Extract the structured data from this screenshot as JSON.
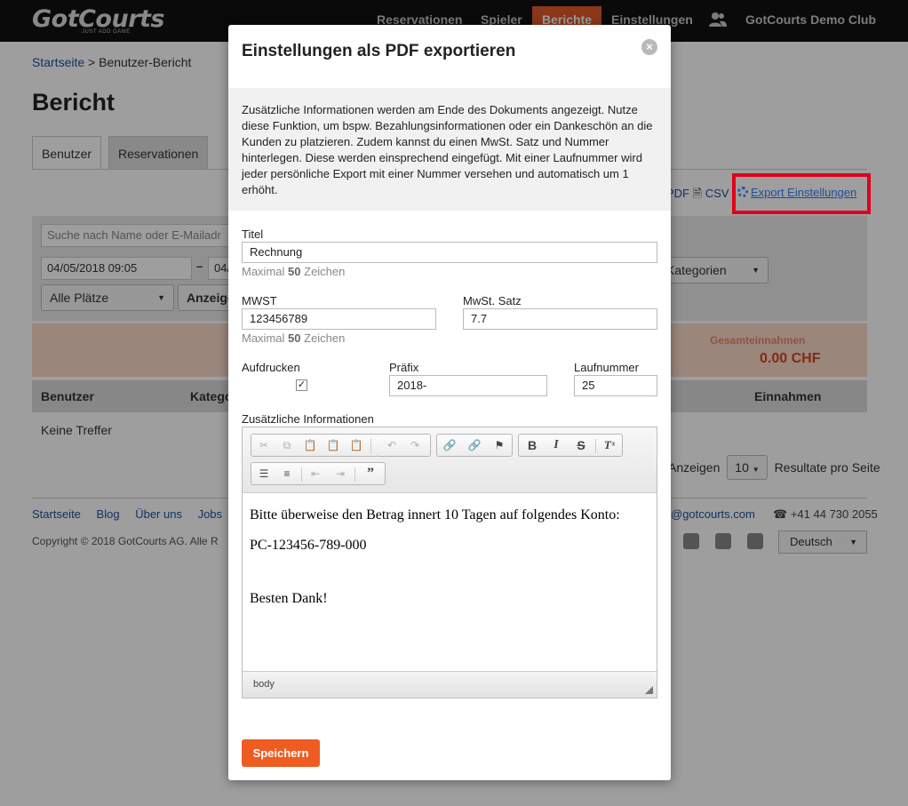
{
  "nav": {
    "logo": "GotCourts",
    "logo_tagline": "JUST ADD GAME",
    "items": [
      "Reservationen",
      "Spieler",
      "Berichte",
      "Einstellungen"
    ],
    "club": "GotCourts Demo Club"
  },
  "page": {
    "breadcrumb_home": "Startseite",
    "breadcrumb_sep": ">",
    "breadcrumb_current": "Benutzer-Bericht",
    "title": "Bericht",
    "tabs": [
      "Benutzer",
      "Reservationen"
    ],
    "export_pdf": "PDF",
    "export_csv": "CSV",
    "export_settings": "Export Einstellungen",
    "search_placeholder": "Suche nach Name oder E-Mailadr",
    "date_from": "04/05/2018 09:05",
    "date_dash": "–",
    "date_to": "04/",
    "courts_select": "Alle Plätze",
    "show_button": "Anzeige",
    "categories_select": "Kategorien",
    "summary_label": "Gesamteinnahmen",
    "summary_value": "0.00 CHF",
    "columns": [
      "Benutzer",
      "Katego",
      "Einnahmen"
    ],
    "no_results": "Keine Treffer",
    "pager_show": "Anzeigen",
    "pager_count": "10",
    "pager_suffix": "Resultate pro Seite"
  },
  "footer": {
    "links": [
      "Startseite",
      "Blog",
      "Über uns",
      "Jobs"
    ],
    "copyright": "Copyright © 2018 GotCourts AG. Alle R",
    "email": "@gotcourts.com",
    "phone": "+41 44 730 2055",
    "language": "Deutsch"
  },
  "modal": {
    "title": "Einstellungen als PDF exportieren",
    "close_symbol": "×",
    "info": "Zusätzliche Informationen werden am Ende des Dokuments angezeigt. Nutze diese Funktion, um bspw. Bezahlungsinformationen oder ein Dankeschön an die Kunden zu platzieren. Zudem kannst du einen MwSt. Satz und Nummer hinterlegen. Diese werden einsprechend eingefügt. Mit einer Laufnummer wird jeder persönliche Export mit einer Nummer versehen und automatisch um 1 erhöht.",
    "title_label": "Titel",
    "title_value": "Rechnung",
    "max_prefix": "Maximal",
    "max_count": "50",
    "max_suffix": "Zeichen",
    "vat_label": "MWST",
    "vat_value": "123456789",
    "vat_rate_label": "MwSt. Satz",
    "vat_rate_value": "7.7",
    "print_label": "Aufdrucken",
    "print_checked": true,
    "prefix_label": "Präfix",
    "prefix_value": "2018-",
    "sequence_label": "Laufnummer",
    "sequence_value": "25",
    "extra_label": "Zusätzliche Informationen",
    "editor_lines": [
      "Bitte überweise den Betrag innert 10 Tagen auf folgendes Konto:",
      "PC-123456-789-000",
      "",
      "Besten Dank!"
    ],
    "editor_status": "body",
    "save_label": "Speichern"
  },
  "colors": {
    "accent": "#ef5c22",
    "highlight_box": "#e0001b",
    "link": "#1f4e9c"
  }
}
